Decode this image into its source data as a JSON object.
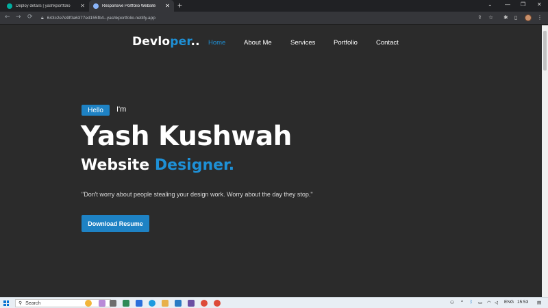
{
  "browser": {
    "tabs": [
      {
        "title": "Deploy details | yashkportfolio",
        "close": "✕",
        "favicon_color": "#00ad9f"
      },
      {
        "title": "Responsive Portfolio Website",
        "close": "✕",
        "favicon_color": "#8ab4f8"
      }
    ],
    "new_tab": "+",
    "url": "643c2e7e9f0a6377ed155fb4--yashkportfolio.netlify.app"
  },
  "site": {
    "logo": {
      "main": "Devlo",
      "accent": "per",
      "suffix": ".."
    },
    "nav": [
      {
        "label": "Home",
        "active": true
      },
      {
        "label": "About Me",
        "active": false
      },
      {
        "label": "Services",
        "active": false
      },
      {
        "label": "Portfolio",
        "active": false
      },
      {
        "label": "Contact",
        "active": false
      }
    ],
    "hero": {
      "hello": "Hello",
      "im": "I'm",
      "name": "Yash Kushwah",
      "role_prefix": "Website",
      "role_accent": "Designer.",
      "quote": "\"Don't worry about people stealing your design work. Worry about the day they stop.\"",
      "cta": "Download Resume"
    },
    "colors": {
      "accent": "#1e90d6",
      "background": "#2b2b2b"
    }
  },
  "taskbar": {
    "search_placeholder": "Search",
    "tray": {
      "language": "ENG",
      "time": "15:53"
    }
  }
}
